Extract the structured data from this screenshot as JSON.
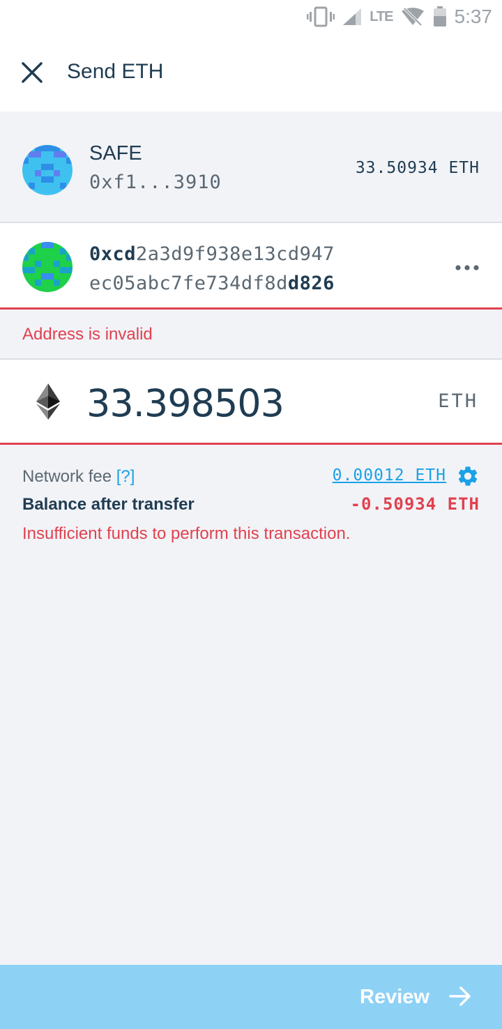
{
  "status_bar": {
    "network": "LTE",
    "time": "5:37",
    "icons": [
      "vibrate-icon",
      "signal-icon",
      "wifi-off-icon",
      "battery-icon"
    ]
  },
  "header": {
    "title": "Send ETH",
    "close_icon": "close-icon"
  },
  "sender": {
    "name": "SAFE",
    "address": "0xf1...3910",
    "balance": "33.50934 ETH"
  },
  "recipient": {
    "address_line1_bold": "0xcd",
    "address_line1_rest": "2a3d9f938e13cd947",
    "address_line2_rest": "ec05abc7fe734df8d",
    "address_line2_bold": "d826",
    "menu_icon": "more-horizontal-icon",
    "error": "Address is invalid"
  },
  "amount": {
    "value": "33.398503",
    "unit": "ETH",
    "icon": "ethereum-icon"
  },
  "fee": {
    "label": "Network fee",
    "help": "[?]",
    "value": "0.00012 ETH",
    "settings_icon": "gear-icon"
  },
  "balance_after": {
    "label": "Balance after transfer",
    "value": "-0.50934 ETH"
  },
  "funds_error": "Insufficient funds to perform this transaction.",
  "review": {
    "label": "Review",
    "icon": "arrow-right-icon"
  },
  "colors": {
    "primary_text": "#1f3c52",
    "secondary_text": "#5b6872",
    "error": "#e0414f",
    "link": "#1aa1e6",
    "review_button": "#8dd1f5",
    "background": "#f2f3f7"
  }
}
